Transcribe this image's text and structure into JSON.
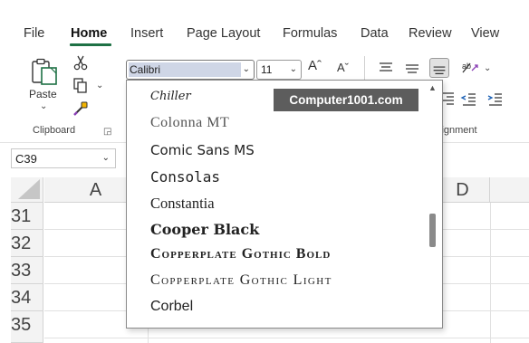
{
  "menu": {
    "tabs": [
      {
        "label": "File"
      },
      {
        "label": "Home",
        "active": true
      },
      {
        "label": "Insert"
      },
      {
        "label": "Page Layout"
      },
      {
        "label": "Formulas"
      },
      {
        "label": "Data"
      },
      {
        "label": "Review"
      },
      {
        "label": "View"
      }
    ]
  },
  "ribbon": {
    "clipboard": {
      "paste_label": "Paste",
      "group_label": "Clipboard",
      "icons": [
        "paste-icon",
        "cut-icon",
        "copy-icon",
        "format-painter-icon",
        "dialog-launcher-icon"
      ]
    },
    "font": {
      "font_name": "Calibri",
      "font_size": "11",
      "grow_label": "Aˆ",
      "shrink_label": "Aˇ"
    },
    "alignment": {
      "group_label_partial": "lignment",
      "icons": [
        "align-top-icon",
        "align-middle-icon",
        "align-bottom-icon",
        "orientation-icon",
        "align-right-icon",
        "decrease-indent-icon",
        "increase-indent-icon"
      ]
    }
  },
  "formula_bar": {
    "name_box": "C39"
  },
  "grid": {
    "columns": [
      "A",
      "D"
    ],
    "rows": [
      "31",
      "32",
      "33",
      "34",
      "35"
    ]
  },
  "font_dropdown": {
    "items": [
      {
        "label": "Chiller"
      },
      {
        "label": "Colonna MT"
      },
      {
        "label": "Comic Sans MS"
      },
      {
        "label": "Consolas"
      },
      {
        "label": "Constantia"
      },
      {
        "label": "Cooper Black"
      },
      {
        "label": "Copperplate Gothic Bold"
      },
      {
        "label": "Copperplate Gothic Light"
      },
      {
        "label": "Corbel"
      }
    ]
  },
  "watermark": {
    "text": "Computer1001.com"
  },
  "colors": {
    "accent": "#1e7145",
    "watermark_bg": "#5d5d5d",
    "header_bg": "#f3f3f3",
    "selection_bg": "#cfd6e6"
  }
}
